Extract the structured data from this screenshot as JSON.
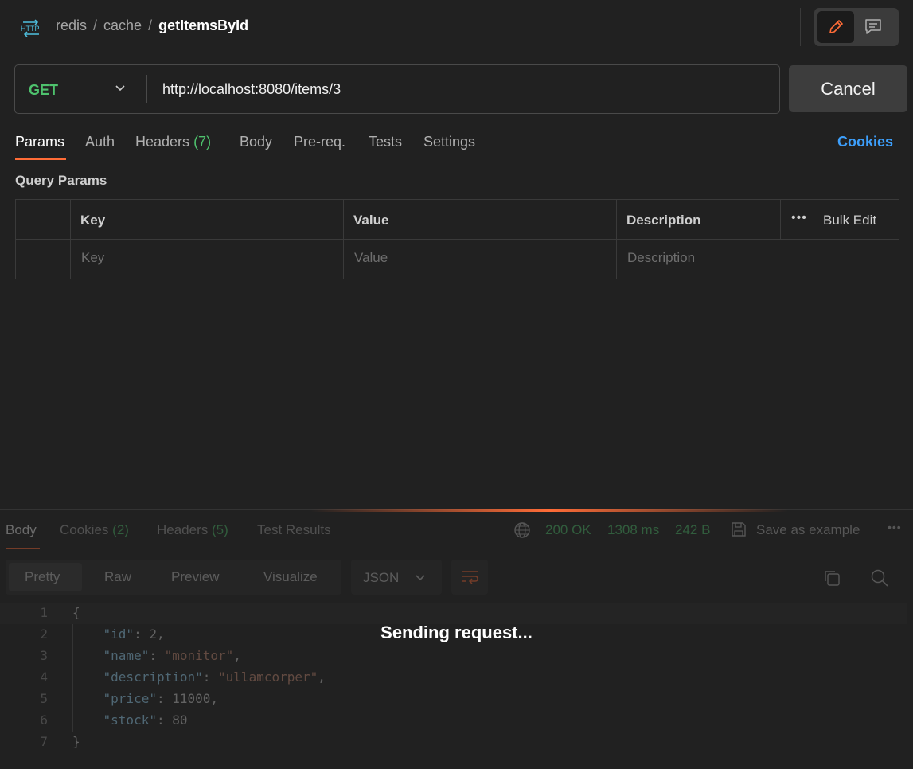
{
  "header": {
    "breadcrumb": [
      "redis",
      "cache",
      "getItemsById"
    ],
    "separator": "/"
  },
  "request": {
    "method": "GET",
    "url": "http://localhost:8080/items/3",
    "action_button": "Cancel"
  },
  "request_tabs": {
    "params": "Params",
    "auth": "Auth",
    "headers": "Headers",
    "headers_count": "(7)",
    "body": "Body",
    "prereq": "Pre-req.",
    "tests": "Tests",
    "settings": "Settings",
    "cookies_link": "Cookies",
    "active": "Params"
  },
  "query_params": {
    "title": "Query Params",
    "columns": [
      "Key",
      "Value",
      "Description"
    ],
    "bulk_edit": "Bulk Edit",
    "placeholders": [
      "Key",
      "Value",
      "Description"
    ]
  },
  "response": {
    "tabs": {
      "body": "Body",
      "cookies": "Cookies",
      "cookies_count": "(2)",
      "headers": "Headers",
      "headers_count": "(5)",
      "test_results": "Test Results"
    },
    "status": "200 OK",
    "time": "1308 ms",
    "size": "242 B",
    "save_example": "Save as example",
    "view_modes": [
      "Pretty",
      "Raw",
      "Preview",
      "Visualize"
    ],
    "active_view": "Pretty",
    "format": "JSON",
    "code_lines": [
      {
        "n": "1",
        "parts": [
          {
            "t": "{",
            "c": "n"
          }
        ]
      },
      {
        "n": "2",
        "parts": [
          {
            "t": "    ",
            "c": "n"
          },
          {
            "t": "\"id\"",
            "c": "k"
          },
          {
            "t": ": 2,",
            "c": "n"
          }
        ]
      },
      {
        "n": "3",
        "parts": [
          {
            "t": "    ",
            "c": "n"
          },
          {
            "t": "\"name\"",
            "c": "k"
          },
          {
            "t": ": ",
            "c": "n"
          },
          {
            "t": "\"monitor\"",
            "c": "s"
          },
          {
            "t": ",",
            "c": "n"
          }
        ]
      },
      {
        "n": "4",
        "parts": [
          {
            "t": "    ",
            "c": "n"
          },
          {
            "t": "\"description\"",
            "c": "k"
          },
          {
            "t": ": ",
            "c": "n"
          },
          {
            "t": "\"ullamcorper\"",
            "c": "s"
          },
          {
            "t": ",",
            "c": "n"
          }
        ]
      },
      {
        "n": "5",
        "parts": [
          {
            "t": "    ",
            "c": "n"
          },
          {
            "t": "\"price\"",
            "c": "k"
          },
          {
            "t": ": 11000,",
            "c": "n"
          }
        ]
      },
      {
        "n": "6",
        "parts": [
          {
            "t": "    ",
            "c": "n"
          },
          {
            "t": "\"stock\"",
            "c": "k"
          },
          {
            "t": ": 80",
            "c": "n"
          }
        ]
      },
      {
        "n": "7",
        "parts": [
          {
            "t": "}",
            "c": "n"
          }
        ]
      }
    ],
    "overlay_message": "Sending request..."
  },
  "colors": {
    "accent": "#ff6c37",
    "method_get": "#4ec26d",
    "link": "#3d9ffb"
  }
}
